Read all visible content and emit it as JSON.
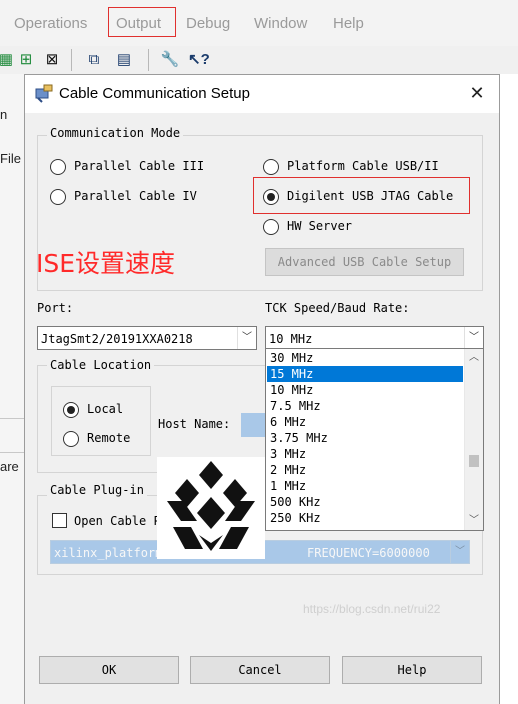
{
  "menubar": {
    "items": [
      "Operations",
      "Output",
      "Debug",
      "Window",
      "Help"
    ],
    "highlighted": "Output"
  },
  "toolbar": {
    "icons": [
      "grid-icon",
      "chip-icon",
      "chip-icon",
      "copy-icon",
      "window-icon",
      "wrench-icon",
      "whats-this-help-icon"
    ]
  },
  "left_panel": {
    "fragments": [
      "n",
      "File",
      "are"
    ]
  },
  "dialog": {
    "title": "Cable Communication Setup",
    "communication_mode": {
      "label": "Communication Mode",
      "options": [
        {
          "label": "Parallel Cable III",
          "selected": false
        },
        {
          "label": "Parallel Cable IV",
          "selected": false
        },
        {
          "label": "Platform Cable USB/II",
          "selected": false
        },
        {
          "label": "Digilent USB JTAG Cable",
          "selected": true
        },
        {
          "label": "HW Server",
          "selected": false
        }
      ],
      "advanced_button": "Advanced USB Cable Setup"
    },
    "port": {
      "label": "Port:",
      "value": "JtagSmt2/20191XXA0218"
    },
    "tck": {
      "label": "TCK Speed/Baud Rate:",
      "value": "10 MHz",
      "options": [
        "30 MHz",
        "15 MHz",
        "10 MHz",
        "7.5 MHz",
        "6 MHz",
        "3.75 MHz",
        "3 MHz",
        "2 MHz",
        "1 MHz",
        "500 KHz",
        "250 KHz"
      ],
      "highlighted": "15 MHz"
    },
    "cable_location": {
      "label": "Cable Location",
      "local": "Local",
      "remote": "Remote",
      "local_selected": true,
      "host_name_label": "Host Name:"
    },
    "plugin": {
      "label": "Cable Plug-in",
      "checkbox_label": "Open Cable Plug-in. Selec",
      "value_left": "xilinx_platformusb",
      "value_right": "FREQUENCY=6000000"
    },
    "buttons": {
      "ok": "OK",
      "cancel": "Cancel",
      "help": "Help"
    }
  },
  "annotation": "ISE设置速度",
  "watermark": "https://blog.csdn.net/rui22",
  "colors": {
    "highlight": "#0078d7",
    "annotation_red": "#ff2a2a",
    "callout_border": "#e0302e",
    "dialog_bg": "#f0f0f0"
  }
}
